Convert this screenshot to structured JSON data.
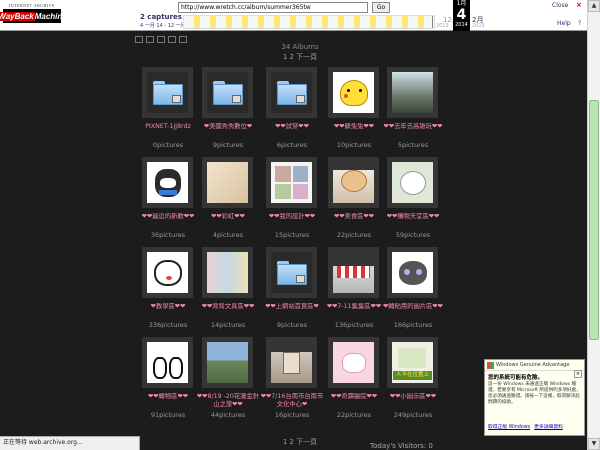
{
  "toolbar": {
    "logo_top": "INTERNET ARCHIVE",
    "logo_w1": "WayBack",
    "logo_w2": "Machine",
    "url": "http://www.wretch.cc/album/summer365tw",
    "go_label": "Go",
    "captures": "2 captures",
    "capture_range": "4 一月 14 - 12 一月 14",
    "prev_month": "12月",
    "cur_month": "1月",
    "cur_day": "4",
    "cur_year": "2014",
    "next_month": "2月",
    "prev_year": "2013",
    "next_year": "2015",
    "close_label": "Close",
    "help_label": "Help",
    "help_icon": "?",
    "close_icon": "×"
  },
  "album": {
    "count": "34 Albums",
    "pager_top": "1 2 下一頁",
    "pager_bottom": "1 2 下一頁",
    "visitors": "Today's Visitors: 0"
  },
  "albums": [
    {
      "name": "PIXNET-1Jj8rdz",
      "pics": "0pictures",
      "thumb": "folder"
    },
    {
      "name": "❤美國秀秀數位❤",
      "pics": "9pictures",
      "thumb": "folder"
    },
    {
      "name": "❤❤試穿❤❤",
      "pics": "6pictures",
      "thumb": "folder"
    },
    {
      "name": "❤❤蘇兔兔❤❤",
      "pics": "10pictures",
      "thumb": "pikachu"
    },
    {
      "name": "❤❤去年去高雄玩❤❤",
      "pics": "5pictures",
      "thumb": "couple"
    },
    {
      "name": "❤❤最近的新歡❤❤",
      "pics": "36pictures",
      "thumb": "bear"
    },
    {
      "name": "❤❤彩虹❤❤",
      "pics": "4pictures",
      "thumb": "soft"
    },
    {
      "name": "❤❤我的設計❤❤",
      "pics": "15pictures",
      "thumb": "design"
    },
    {
      "name": "❤❤美食區❤❤",
      "pics": "22pictures",
      "thumb": "food"
    },
    {
      "name": "❤❤購物天堂區❤❤",
      "pics": "59pictures",
      "thumb": "bunny"
    },
    {
      "name": "❤教學區❤❤",
      "pics": "336pictures",
      "thumb": "sticker"
    },
    {
      "name": "❤❤背背文具區❤❤",
      "pics": "14pictures",
      "thumb": "stationery"
    },
    {
      "name": "❤❤上網站首頁區❤",
      "pics": "9pictures",
      "thumb": "folder"
    },
    {
      "name": "❤❤7-11集集區❤❤",
      "pics": "136pictures",
      "thumb": "shop"
    },
    {
      "name": "❤轉貼用的圖片區❤❤",
      "pics": "166pictures",
      "thumb": "cat"
    },
    {
      "name": "❤❤轉物區❤❤",
      "pics": "91pictures",
      "thumb": "rabbits"
    },
    {
      "name": "❤❤8/19 -20花蓮金針山之旅❤❤",
      "pics": "44pictures",
      "thumb": "scenery"
    },
    {
      "name": "❤❤7/16台南市台南市文化中心❤",
      "pics": "16pictures",
      "thumb": "house"
    },
    {
      "name": "❤❤奇蹟醫院❤❤",
      "pics": "22pictures",
      "thumb": "pink"
    },
    {
      "name": "❤❤小圖示區❤❤",
      "pics": "249pictures",
      "thumb": "banner"
    }
  ],
  "status": "正在等待 web.archive.org...",
  "wga": {
    "title": "Windows Genuine Advantage",
    "headline": "您的系統可能有危險。",
    "body": "這一份 Windows 未通過正版 Windows 驗證。若要享有 Microsoft 所提供的多項好處，您必須通過驗證。請按一下這裡，取得解決此問題的協助。",
    "link1": "取得正版 Windows",
    "link2": "更多詳細資料"
  },
  "colors": {
    "background": "#1c1c1c",
    "name_pink": "#f08aa4",
    "tile": "#353535"
  }
}
